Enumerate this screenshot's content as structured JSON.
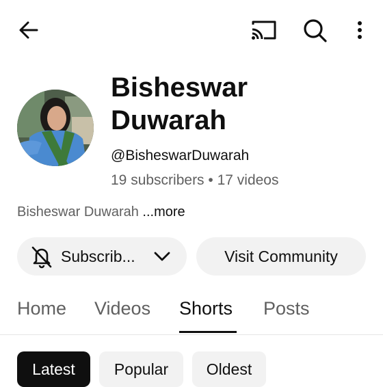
{
  "channel": {
    "name": "Bisheswar Duwarah",
    "handle": "@BisheswarDuwarah",
    "stats": "19 subscribers • 17 videos",
    "description": "Bisheswar Duwarah",
    "more_label": "...more"
  },
  "actions": {
    "subscribe_label": "Subscrib...",
    "community_label": "Visit Community"
  },
  "tabs": [
    {
      "label": "Home",
      "active": false
    },
    {
      "label": "Videos",
      "active": false
    },
    {
      "label": "Shorts",
      "active": true
    },
    {
      "label": "Posts",
      "active": false
    }
  ],
  "chips": [
    {
      "label": "Latest",
      "selected": true
    },
    {
      "label": "Popular",
      "selected": false
    },
    {
      "label": "Oldest",
      "selected": false
    }
  ],
  "icons": {
    "back": "arrow-back-icon",
    "cast": "cast-icon",
    "search": "search-icon",
    "more": "more-vert-icon",
    "bell": "bell-off-icon",
    "chevron": "chevron-down-icon"
  }
}
